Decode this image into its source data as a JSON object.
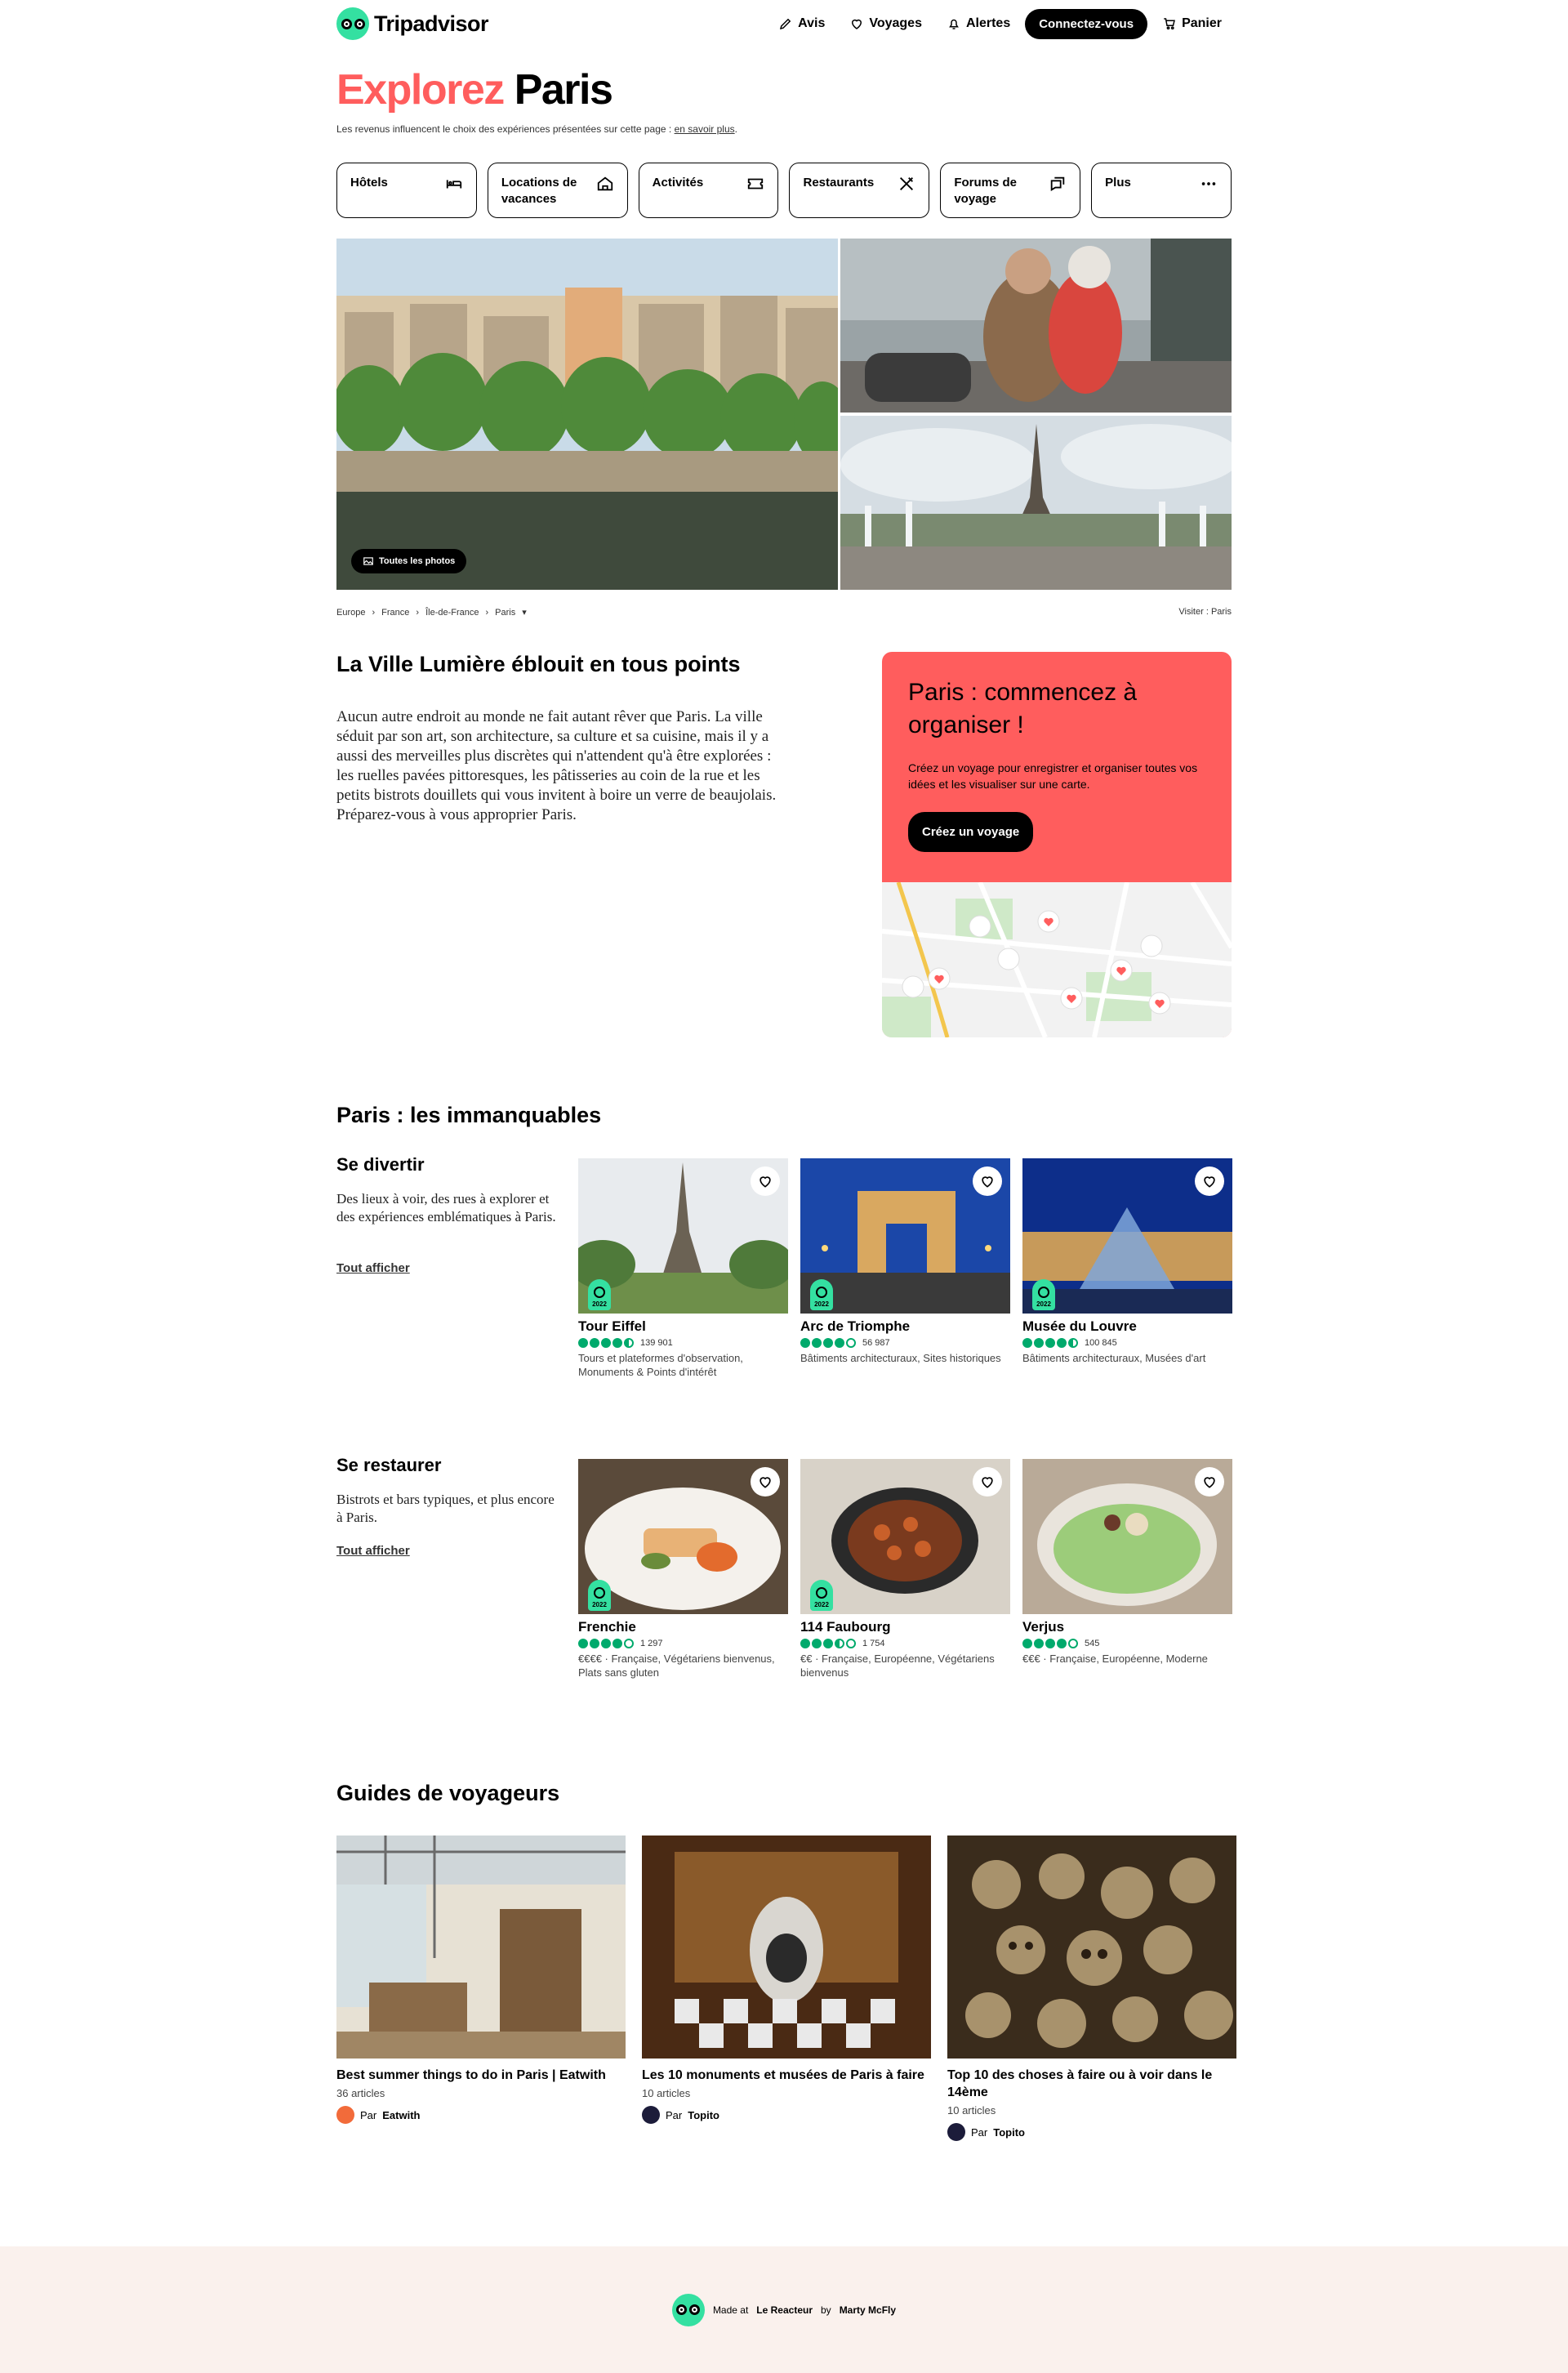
{
  "header": {
    "logo_text": "Tripadvisor",
    "nav": {
      "reviews": "Avis",
      "trips": "Voyages",
      "alerts": "Alertes",
      "login": "Connectez-vous",
      "cart": "Panier"
    }
  },
  "hero": {
    "title_accent": "Explorez",
    "title_city": "Paris",
    "disclaimer": "Les revenus influencent le choix des expériences présentées sur cette page :",
    "disclaimer_link": "en savoir plus",
    "disclaimer_end": "."
  },
  "tabs": [
    {
      "label": "Hôtels",
      "icon": "bed-icon"
    },
    {
      "label": "Locations de vacances",
      "icon": "house-icon"
    },
    {
      "label": "Activités",
      "icon": "ticket-icon"
    },
    {
      "label": "Restaurants",
      "icon": "cutlery-icon"
    },
    {
      "label": "Forums de voyage",
      "icon": "chat-icon"
    },
    {
      "label": "Plus",
      "icon": "more-icon"
    }
  ],
  "gallery": {
    "all_photos": "Toutes les photos"
  },
  "breadcrumbs": [
    "Europe",
    "France",
    "Île-de-France",
    "Paris"
  ],
  "visit_label": "Visiter : Paris",
  "intro": {
    "title": "La Ville Lumière éblouit en tous points",
    "text": "Aucun autre endroit au monde ne fait autant rêver que Paris. La ville séduit par son art, son architecture, sa culture et sa cuisine, mais il y a aussi des merveilles plus discrètes qui n'attendent qu'à être explorées : les ruelles pavées pittoresques, les pâtisseries au coin de la rue et les petits bistrots douillets qui vous invitent à boire un verre de beaujolais. Préparez-vous à vous approprier Paris."
  },
  "plan": {
    "title": "Paris : commencez à organiser !",
    "text": "Créez un voyage pour enregistrer et organiser toutes vos idées et les visualiser sur une carte.",
    "button": "Créez un voyage"
  },
  "must_see": {
    "title": "Paris : les immanquables",
    "entertain": {
      "title": "Se divertir",
      "desc": "Des lieux à voir, des rues à explorer et des expériences emblématiques à Paris.",
      "see_all": "Tout afficher",
      "cards": [
        {
          "name": "Tour Eiffel",
          "rating": 4.5,
          "reviews": "139 901",
          "meta": "Tours et plateformes d'observation, Monuments & Points d'intérêt",
          "badge": "2022"
        },
        {
          "name": "Arc de Triomphe",
          "rating": 4.0,
          "reviews": "56 987",
          "meta": "Bâtiments architecturaux, Sites historiques",
          "badge": "2022"
        },
        {
          "name": "Musée du Louvre",
          "rating": 4.5,
          "reviews": "100 845",
          "meta": "Bâtiments architecturaux, Musées d'art",
          "badge": "2022"
        }
      ]
    },
    "dine": {
      "title": "Se restaurer",
      "desc": "Bistrots et bars typiques, et plus encore à Paris.",
      "see_all": "Tout afficher",
      "cards": [
        {
          "name": "Frenchie",
          "rating": 4.0,
          "reviews": "1 297",
          "meta": "€€€€ · Française, Végétariens bienvenus, Plats sans gluten",
          "badge": "2022"
        },
        {
          "name": "114 Faubourg",
          "rating": 3.5,
          "reviews": "1 754",
          "meta": "€€ · Française, Européenne, Végétariens bienvenus",
          "badge": "2022"
        },
        {
          "name": "Verjus",
          "rating": 4.0,
          "reviews": "545",
          "meta": "€€€ · Française, Européenne, Moderne",
          "badge": ""
        }
      ]
    }
  },
  "guides": {
    "title": "Guides de voyageurs",
    "items": [
      {
        "title": "Best summer things to do in Paris | Eatwith",
        "count": "36 articles",
        "by": "Par",
        "author": "Eatwith",
        "avatar_color": "#f26b3a"
      },
      {
        "title": "Les 10 monuments et musées de Paris à faire",
        "count": "10 articles",
        "by": "Par",
        "author": "Topito",
        "avatar_color": "#1c1c3a"
      },
      {
        "title": "Top 10 des choses à faire ou à voir dans le 14ème",
        "count": "10 articles",
        "by": "Par",
        "author": "Topito",
        "avatar_color": "#1c1c3a"
      }
    ]
  },
  "footer": {
    "made_at": "Made at",
    "school": "Le Reacteur",
    "by": "by",
    "author": "Marty McFly"
  },
  "colors": {
    "brand_green": "#34e0a1",
    "accent_red": "#ff5d5d",
    "rating_green": "#00aa6c",
    "footer_bg": "#faf1ed"
  }
}
